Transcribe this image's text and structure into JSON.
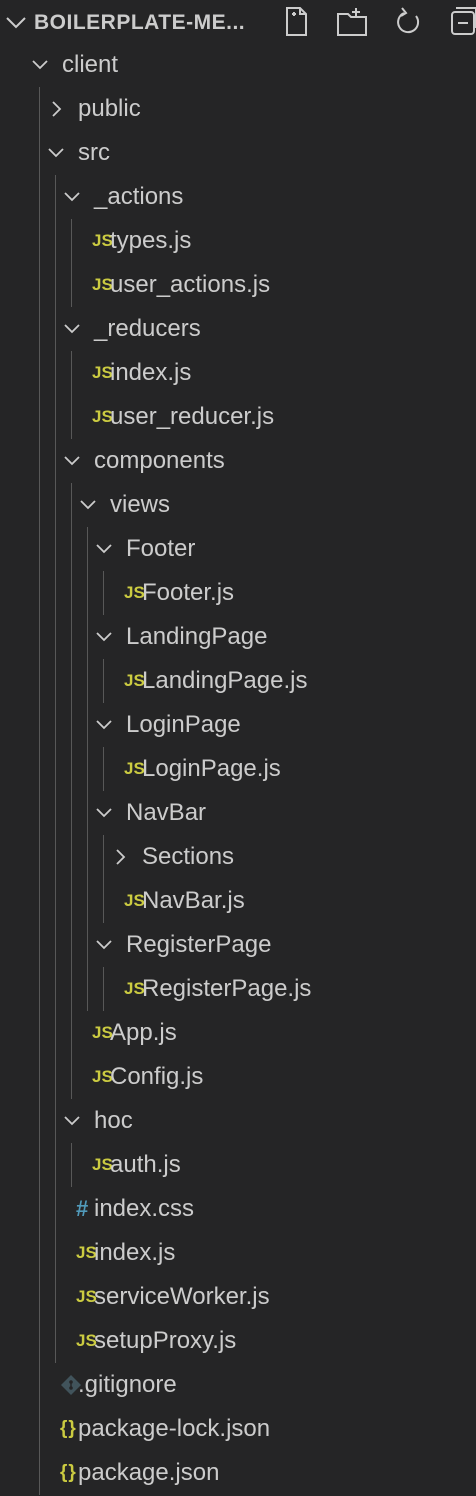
{
  "explorer": {
    "title": "BOILERPLATE-ME...",
    "actions": [
      {
        "name": "new-file-icon"
      },
      {
        "name": "new-folder-icon"
      },
      {
        "name": "refresh-icon"
      },
      {
        "name": "collapse-all-icon"
      }
    ]
  },
  "colors": {
    "background": "#252526",
    "text": "#cccccc",
    "js_icon": "#cbcb41",
    "css_icon": "#519aba",
    "git_icon": "#41535b",
    "json_icon": "#cbcb41",
    "indent_guide": "#585858"
  },
  "tree": [
    {
      "label": "client",
      "type": "folder",
      "expanded": true,
      "depth": 1
    },
    {
      "label": "public",
      "type": "folder",
      "expanded": false,
      "depth": 2
    },
    {
      "label": "src",
      "type": "folder",
      "expanded": true,
      "depth": 2
    },
    {
      "label": "_actions",
      "type": "folder",
      "expanded": true,
      "depth": 3
    },
    {
      "label": "types.js",
      "type": "file",
      "icon": "JS",
      "depth": 4
    },
    {
      "label": "user_actions.js",
      "type": "file",
      "icon": "JS",
      "depth": 4
    },
    {
      "label": "_reducers",
      "type": "folder",
      "expanded": true,
      "depth": 3
    },
    {
      "label": "index.js",
      "type": "file",
      "icon": "JS",
      "depth": 4
    },
    {
      "label": "user_reducer.js",
      "type": "file",
      "icon": "JS",
      "depth": 4
    },
    {
      "label": "components",
      "type": "folder",
      "expanded": true,
      "depth": 3
    },
    {
      "label": "views",
      "type": "folder",
      "expanded": true,
      "depth": 4
    },
    {
      "label": "Footer",
      "type": "folder",
      "expanded": true,
      "depth": 5
    },
    {
      "label": "Footer.js",
      "type": "file",
      "icon": "JS",
      "depth": 6
    },
    {
      "label": "LandingPage",
      "type": "folder",
      "expanded": true,
      "depth": 5
    },
    {
      "label": "LandingPage.js",
      "type": "file",
      "icon": "JS",
      "depth": 6
    },
    {
      "label": "LoginPage",
      "type": "folder",
      "expanded": true,
      "depth": 5
    },
    {
      "label": "LoginPage.js",
      "type": "file",
      "icon": "JS",
      "depth": 6
    },
    {
      "label": "NavBar",
      "type": "folder",
      "expanded": true,
      "depth": 5
    },
    {
      "label": "Sections",
      "type": "folder",
      "expanded": false,
      "depth": 6
    },
    {
      "label": "NavBar.js",
      "type": "file",
      "icon": "JS",
      "depth": 6
    },
    {
      "label": "RegisterPage",
      "type": "folder",
      "expanded": true,
      "depth": 5
    },
    {
      "label": "RegisterPage.js",
      "type": "file",
      "icon": "JS",
      "depth": 6
    },
    {
      "label": "App.js",
      "type": "file",
      "icon": "JS",
      "depth": 4
    },
    {
      "label": "Config.js",
      "type": "file",
      "icon": "JS",
      "depth": 4
    },
    {
      "label": "hoc",
      "type": "folder",
      "expanded": true,
      "depth": 3
    },
    {
      "label": "auth.js",
      "type": "file",
      "icon": "JS",
      "depth": 4
    },
    {
      "label": "index.css",
      "type": "file",
      "icon": "#",
      "depth": 3
    },
    {
      "label": "index.js",
      "type": "file",
      "icon": "JS",
      "depth": 3
    },
    {
      "label": "serviceWorker.js",
      "type": "file",
      "icon": "JS",
      "depth": 3
    },
    {
      "label": "setupProxy.js",
      "type": "file",
      "icon": "JS",
      "depth": 3
    },
    {
      "label": ".gitignore",
      "type": "file",
      "icon": "git-icon",
      "depth": 2
    },
    {
      "label": "package-lock.json",
      "type": "file",
      "icon": "{}",
      "depth": 2
    },
    {
      "label": "package.json",
      "type": "file",
      "icon": "{}",
      "depth": 2
    }
  ]
}
